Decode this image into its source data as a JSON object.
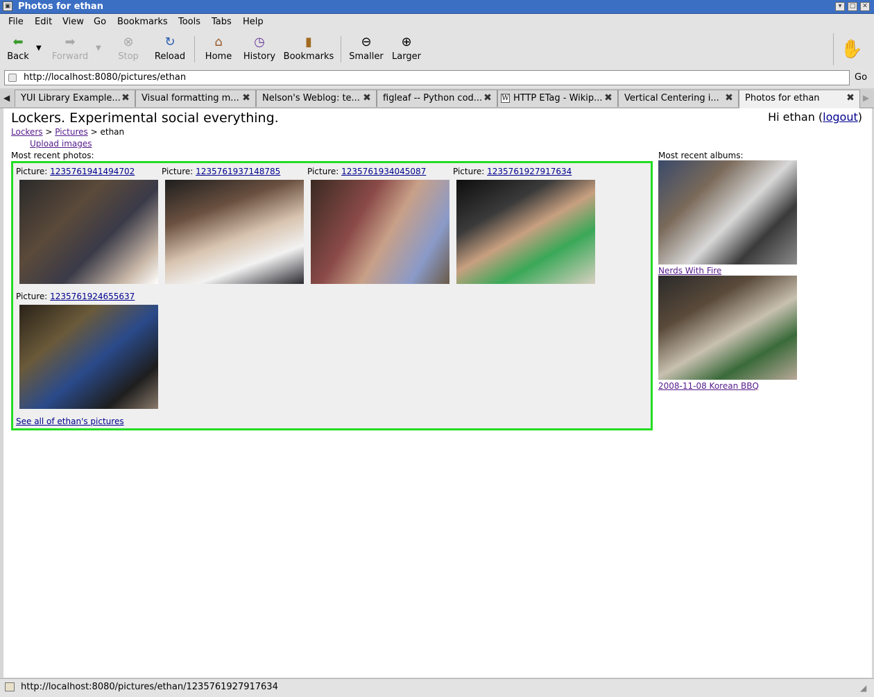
{
  "window": {
    "title": "Photos for ethan"
  },
  "menu": [
    "File",
    "Edit",
    "View",
    "Go",
    "Bookmarks",
    "Tools",
    "Tabs",
    "Help"
  ],
  "toolbar": {
    "back": "Back",
    "forward": "Forward",
    "stop": "Stop",
    "reload": "Reload",
    "home": "Home",
    "history": "History",
    "bookmarks": "Bookmarks",
    "smaller": "Smaller",
    "larger": "Larger"
  },
  "location": {
    "url": "http://localhost:8080/pictures/ethan",
    "go": "Go"
  },
  "tabs": [
    {
      "label": "YUI Library Example..."
    },
    {
      "label": "Visual formatting m..."
    },
    {
      "label": "Nelson's Weblog: te..."
    },
    {
      "label": "figleaf -- Python cod..."
    },
    {
      "label": "HTTP ETag - Wikip..."
    },
    {
      "label": "Vertical Centering i..."
    },
    {
      "label": "Photos for ethan"
    }
  ],
  "page": {
    "heading": "Lockers. Experimental social everything.",
    "greeting": "Hi ethan (",
    "logout": "logout",
    "greeting_end": ")",
    "breadcrumb": {
      "home": "Lockers",
      "sep1": ">",
      "pictures": "Pictures",
      "sep2": ">",
      "current": "ethan"
    },
    "upload": "Upload images",
    "recent_photos_label": "Most recent photos:",
    "picture_prefix": "Picture:",
    "photos": [
      {
        "id": "1235761941494702"
      },
      {
        "id": "1235761937148785"
      },
      {
        "id": "1235761934045087"
      },
      {
        "id": "1235761927917634"
      },
      {
        "id": "1235761924655637"
      }
    ],
    "see_all": "See all of ethan's pictures",
    "recent_albums_label": "Most recent albums:",
    "albums": [
      {
        "name": "Nerds With Fire"
      },
      {
        "name": "2008-11-08 Korean BBQ"
      }
    ]
  },
  "status": {
    "url": "http://localhost:8080/pictures/ethan/1235761927917634"
  }
}
